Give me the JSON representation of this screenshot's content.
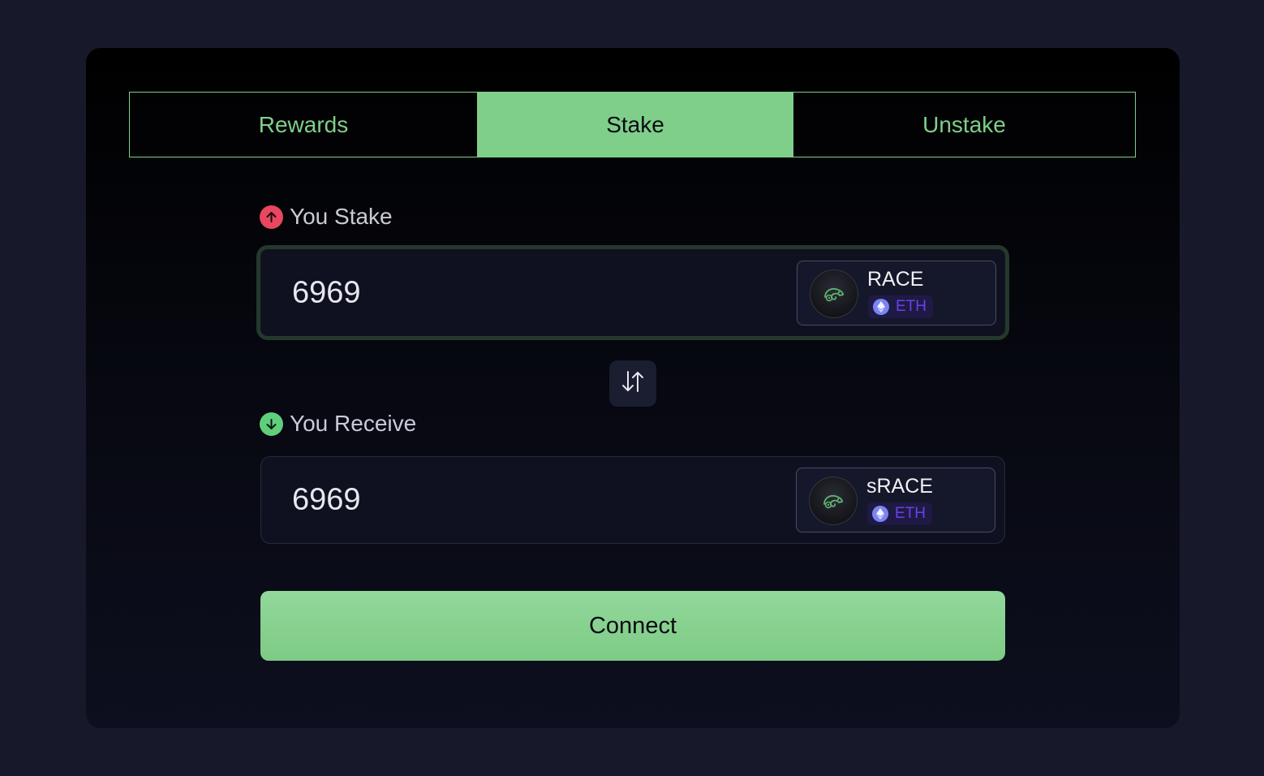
{
  "tabs": [
    {
      "label": "Rewards",
      "active": false
    },
    {
      "label": "Stake",
      "active": true
    },
    {
      "label": "Unstake",
      "active": false
    }
  ],
  "stake": {
    "label": "You Stake",
    "amount": "6969",
    "token": {
      "name": "RACE",
      "chain": "ETH"
    }
  },
  "receive": {
    "label": "You Receive",
    "amount": "6969",
    "token": {
      "name": "sRACE",
      "chain": "ETH"
    }
  },
  "connect_label": "Connect",
  "colors": {
    "accent": "#7fcf8a",
    "stake_arrow": "#e8475f",
    "receive_arrow": "#5fcf7c",
    "chain_text": "#6a41e8",
    "background": "#17192b"
  },
  "icons": {
    "stake": "arrow-up-icon",
    "receive": "arrow-down-icon",
    "swap": "swap-vertical-icon",
    "token_logo": "chameleon-icon",
    "chain": "ethereum-icon"
  }
}
